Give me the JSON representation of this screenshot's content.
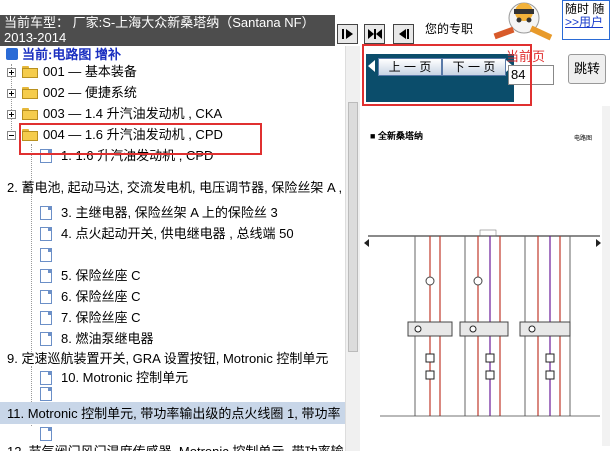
{
  "header": {
    "vehicle_info": "当前车型：  厂家:S-上海大众新桑塔纳（Santana NF）2013-2014",
    "pro_label": "您的专职",
    "promo_line1": "随时 随",
    "promo_link": ">>用户"
  },
  "tree": {
    "title": "当前:电路图 增补",
    "items": [
      {
        "label": "001 — 基本装备"
      },
      {
        "label": "002 — 便捷系统"
      },
      {
        "label": "003 — 1.4 升汽油发动机 , CKA"
      },
      {
        "label": "004 — 1.6 升汽油发动机 , CPD"
      },
      {
        "label": "1. 1.6 升汽油发动机 , CPD"
      },
      {
        "label": "2. 蓄电池, 起动马达, 交流发电机, 电压调节器, 保险丝架 A ,"
      },
      {
        "label": "3. 主继电器, 保险丝架 A 上的保险丝 3"
      },
      {
        "label": "4. 点火起动开关, 供电继电器 , 总线端 50"
      },
      {
        "label": "5. 保险丝座 C"
      },
      {
        "label": "6. 保险丝座 C"
      },
      {
        "label": "7. 保险丝座 C"
      },
      {
        "label": "8. 燃油泵继电器"
      },
      {
        "label": "9. 定速巡航装置开关, GRA 设置按钮, Motronic 控制单元"
      },
      {
        "label": "10. Motronic 控制单元"
      },
      {
        "label": "11. Motronic 控制单元, 带功率输出级的点火线圈 1, 带功率"
      },
      {
        "label": "12. 节气阀门风门温度传感器, Motronic 控制单元, 带功率输"
      }
    ]
  },
  "nav": {
    "prev_label": "上 一 页",
    "next_label": "下 一 页",
    "current_page_label": "当前页",
    "page_value": "84",
    "jump_label": "跳转"
  },
  "document": {
    "title": "全新桑塔纳",
    "right_label": "电路图"
  },
  "colors": {
    "highlight_border": "#e03030",
    "nav_background": "#0b4d6b",
    "tree_selected": "#c8d6e8"
  }
}
